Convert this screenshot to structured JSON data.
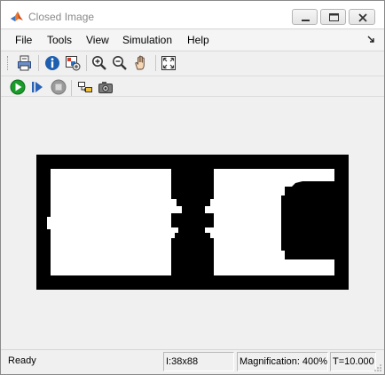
{
  "window": {
    "title": "Closed Image",
    "controls": {
      "minimize": "minimize-icon",
      "maximize": "maximize-icon",
      "close": "close-icon"
    }
  },
  "menubar": {
    "items": [
      "File",
      "Tools",
      "View",
      "Simulation",
      "Help"
    ],
    "dock_icon": "undock-arrow-icon"
  },
  "toolbar1": {
    "buttons": [
      "print-icon",
      "info-icon",
      "image-properties-icon",
      "zoom-in-icon",
      "zoom-out-icon",
      "pan-hand-icon",
      "fit-to-window-icon"
    ]
  },
  "toolbar2": {
    "buttons": [
      "run-icon",
      "step-forward-icon",
      "stop-icon",
      "highlight-block-icon",
      "snapshot-camera-icon"
    ]
  },
  "image": {
    "description_icon": "binary-image",
    "background": "#ffffff",
    "foreground": "#000000"
  },
  "statusbar": {
    "state": "Ready",
    "size": "I:38x88",
    "magnification": "Magnification: 400%",
    "time": "T=10.000"
  },
  "colors": {
    "run_green": "#1a9b2a",
    "stop_gray": "#8c8c8c",
    "info_blue": "#1d5fae"
  }
}
